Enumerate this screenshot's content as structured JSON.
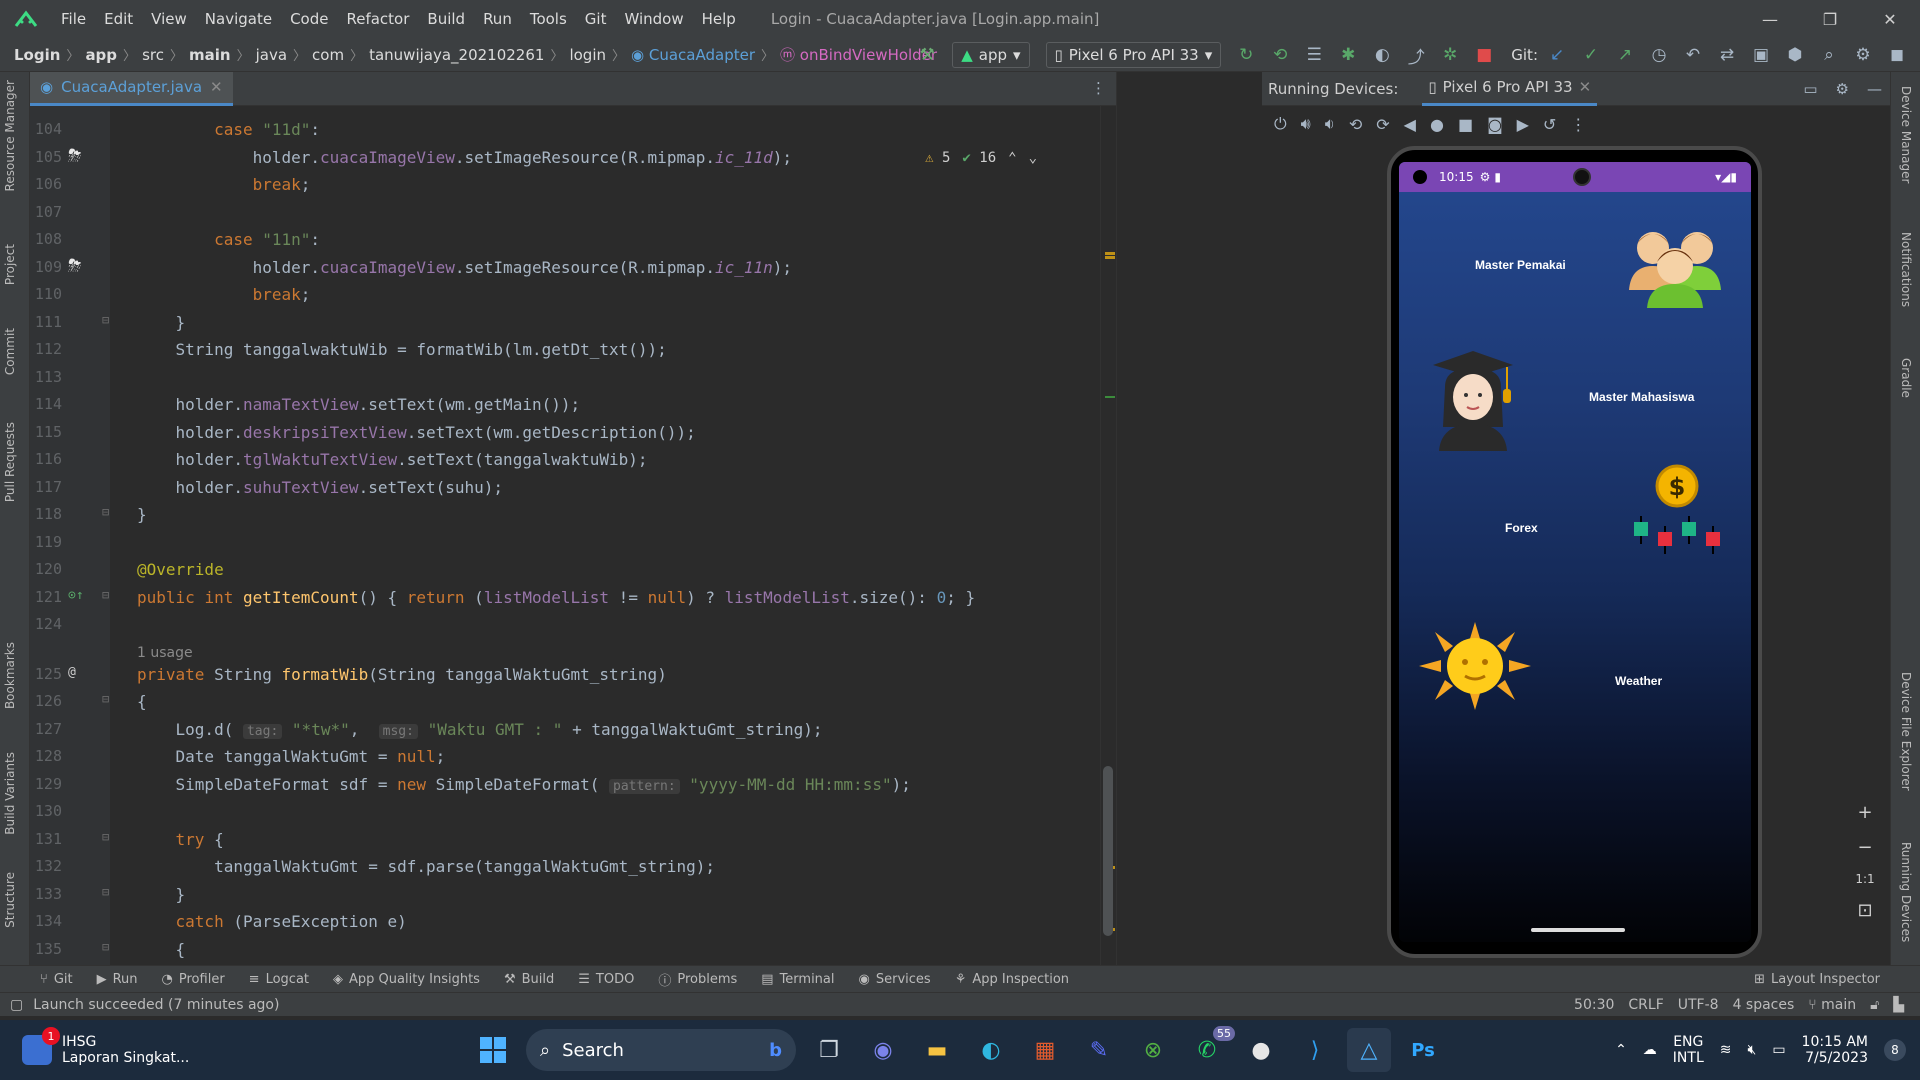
{
  "window": {
    "title": "Login - CuacaAdapter.java [Login.app.main]",
    "controls": [
      "—",
      "❐",
      "✕"
    ]
  },
  "menu": [
    "File",
    "Edit",
    "View",
    "Navigate",
    "Code",
    "Refactor",
    "Build",
    "Run",
    "Tools",
    "Git",
    "Window",
    "Help"
  ],
  "breadcrumb": [
    "Login",
    "app",
    "src",
    "main",
    "java",
    "com",
    "tanuwijaya_202102261",
    "login",
    "CuacaAdapter",
    "onBindViewHolder"
  ],
  "toolbar": {
    "run_config": "app",
    "device": "Pixel 6 Pro API 33",
    "git_label": "Git:"
  },
  "editor": {
    "tab": "CuacaAdapter.java",
    "warnings": "5",
    "checks": "16",
    "usage_hint": "1 usage",
    "lines": [
      {
        "n": "104",
        "code": "        case \"11d\":"
      },
      {
        "n": "105",
        "code": "            holder.cuacaImageView.setImageResource(R.mipmap.ic_11d);"
      },
      {
        "n": "106",
        "code": "            break;"
      },
      {
        "n": "107",
        "code": ""
      },
      {
        "n": "108",
        "code": "        case \"11n\":"
      },
      {
        "n": "109",
        "code": "            holder.cuacaImageView.setImageResource(R.mipmap.ic_11n);"
      },
      {
        "n": "110",
        "code": "            break;"
      },
      {
        "n": "111",
        "code": "    }"
      },
      {
        "n": "112",
        "code": "    String tanggalwaktuWib = formatWib(lm.getDt_txt());"
      },
      {
        "n": "113",
        "code": ""
      },
      {
        "n": "114",
        "code": "    holder.namaTextView.setText(wm.getMain());"
      },
      {
        "n": "115",
        "code": "    holder.deskripsiTextView.setText(wm.getDescription());"
      },
      {
        "n": "116",
        "code": "    holder.tglWaktuTextView.setText(tanggalwaktuWib);"
      },
      {
        "n": "117",
        "code": "    holder.suhuTextView.setText(suhu);"
      },
      {
        "n": "118",
        "code": "}"
      },
      {
        "n": "119",
        "code": ""
      },
      {
        "n": "120",
        "code": "@Override"
      },
      {
        "n": "121",
        "code": "public int getItemCount() { return (listModelList != null) ? listModelList.size(): 0; }"
      },
      {
        "n": "124",
        "code": ""
      },
      {
        "n": "125",
        "code": "private String formatWib(String tanggalWaktuGmt_string)"
      },
      {
        "n": "126",
        "code": "{"
      },
      {
        "n": "127",
        "code": "    Log.d( tag: \"*tw*\",  msg: \"Waktu GMT : \" + tanggalWaktuGmt_string);"
      },
      {
        "n": "128",
        "code": "    Date tanggalWaktuGmt = null;"
      },
      {
        "n": "129",
        "code": "    SimpleDateFormat sdf = new SimpleDateFormat( pattern: \"yyyy-MM-dd HH:mm:ss\");"
      },
      {
        "n": "130",
        "code": ""
      },
      {
        "n": "131",
        "code": "    try {"
      },
      {
        "n": "132",
        "code": "        tanggalWaktuGmt = sdf.parse(tanggalWaktuGmt_string);"
      },
      {
        "n": "133",
        "code": "    }"
      },
      {
        "n": "134",
        "code": "    catch (ParseException e)"
      },
      {
        "n": "135",
        "code": "    {"
      }
    ]
  },
  "device_panel": {
    "title": "Running Devices:",
    "tab": "Pixel 6 Pro API 33",
    "phone_time": "10:15",
    "tiles": [
      "Master Pemakai",
      "Master Mahasiswa",
      "Forex",
      "Weather"
    ],
    "zoom_ratio": "1:1"
  },
  "left_tabs": [
    "Resource Manager",
    "Project",
    "Commit",
    "Pull Requests",
    "Bookmarks",
    "Build Variants",
    "Structure"
  ],
  "right_tabs": [
    "Device Manager",
    "Notifications",
    "Gradle",
    "Device File Explorer",
    "Running Devices"
  ],
  "bottom_tabs": [
    "Git",
    "Run",
    "Profiler",
    "Logcat",
    "App Quality Insights",
    "Build",
    "TODO",
    "Problems",
    "Terminal",
    "Services",
    "App Inspection"
  ],
  "bottom_right_tab": "Layout Inspector",
  "status": {
    "message": "Launch succeeded (7 minutes ago)",
    "position": "50:30",
    "line_sep": "CRLF",
    "encoding": "UTF-8",
    "indent": "4 spaces",
    "branch": "main"
  },
  "taskbar": {
    "news_title": "IHSG",
    "news_sub": "Laporan Singkat...",
    "news_badge": "1",
    "search": "Search",
    "whatsapp_badge": "55",
    "lang": "ENG",
    "lang_sub": "INTL",
    "time": "10:15 AM",
    "date": "7/5/2023",
    "notif_count": "8"
  }
}
